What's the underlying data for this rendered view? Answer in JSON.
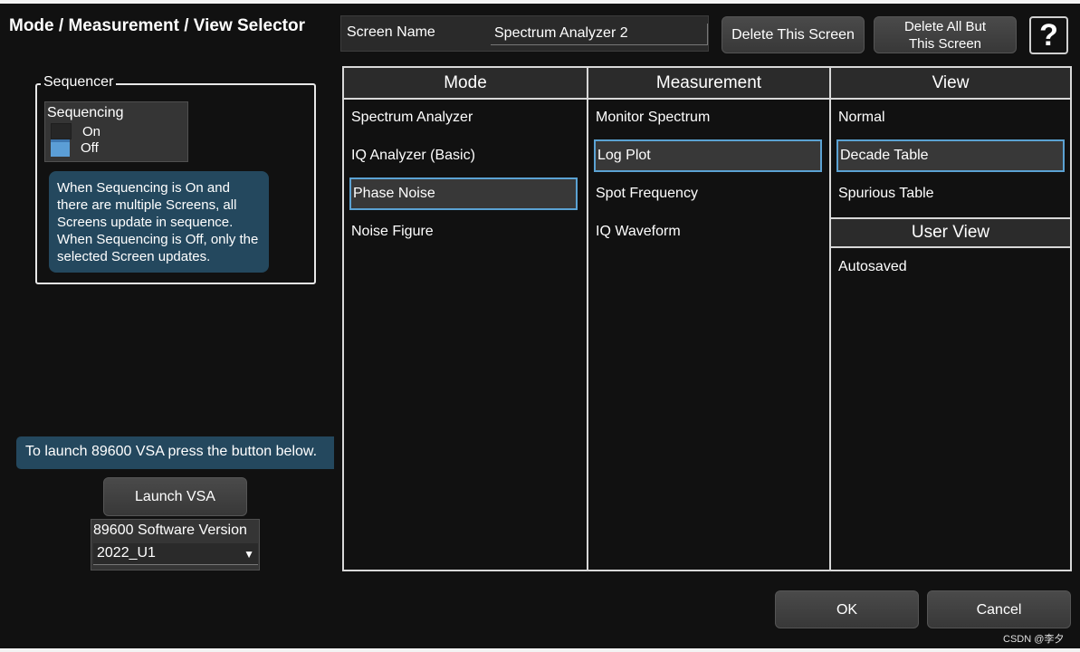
{
  "dialog": {
    "title": "Mode / Measurement / View Selector"
  },
  "screen": {
    "name_label": "Screen Name",
    "name_value": "Spectrum Analyzer 2"
  },
  "buttons": {
    "delete_screen": "Delete This Screen",
    "delete_all_but": "Delete All But\nThis Screen",
    "help": "?",
    "launch_vsa": "Launch VSA",
    "ok": "OK",
    "cancel": "Cancel"
  },
  "sequencer": {
    "legend": "Sequencer",
    "label": "Sequencing",
    "options": [
      "On",
      "Off"
    ],
    "selected": "Off",
    "info": "When Sequencing is On and there are multiple Screens, all Screens update in sequence. When Sequencing is Off, only the selected Screen updates."
  },
  "vsa": {
    "info": "To launch 89600 VSA press the button below.",
    "version_label": "89600 Software Version",
    "version_value": "2022_U1"
  },
  "columns": {
    "mode": {
      "header": "Mode",
      "items": [
        "Spectrum Analyzer",
        "IQ Analyzer (Basic)",
        "Phase Noise",
        "Noise Figure"
      ],
      "selected": "Phase Noise"
    },
    "measurement": {
      "header": "Measurement",
      "items": [
        "Monitor Spectrum",
        "Log Plot",
        "Spot Frequency",
        "IQ Waveform"
      ],
      "selected": "Log Plot"
    },
    "view": {
      "header": "View",
      "items": [
        "Normal",
        "Decade Table",
        "Spurious Table"
      ],
      "selected": "Decade Table",
      "user_view_header": "User View",
      "user_view_items": [
        "Autosaved"
      ]
    }
  },
  "colors": {
    "highlight": "#5ba2d3",
    "info_bg": "#24485e",
    "background": "#111111"
  },
  "watermark": "CSDN @李夕"
}
